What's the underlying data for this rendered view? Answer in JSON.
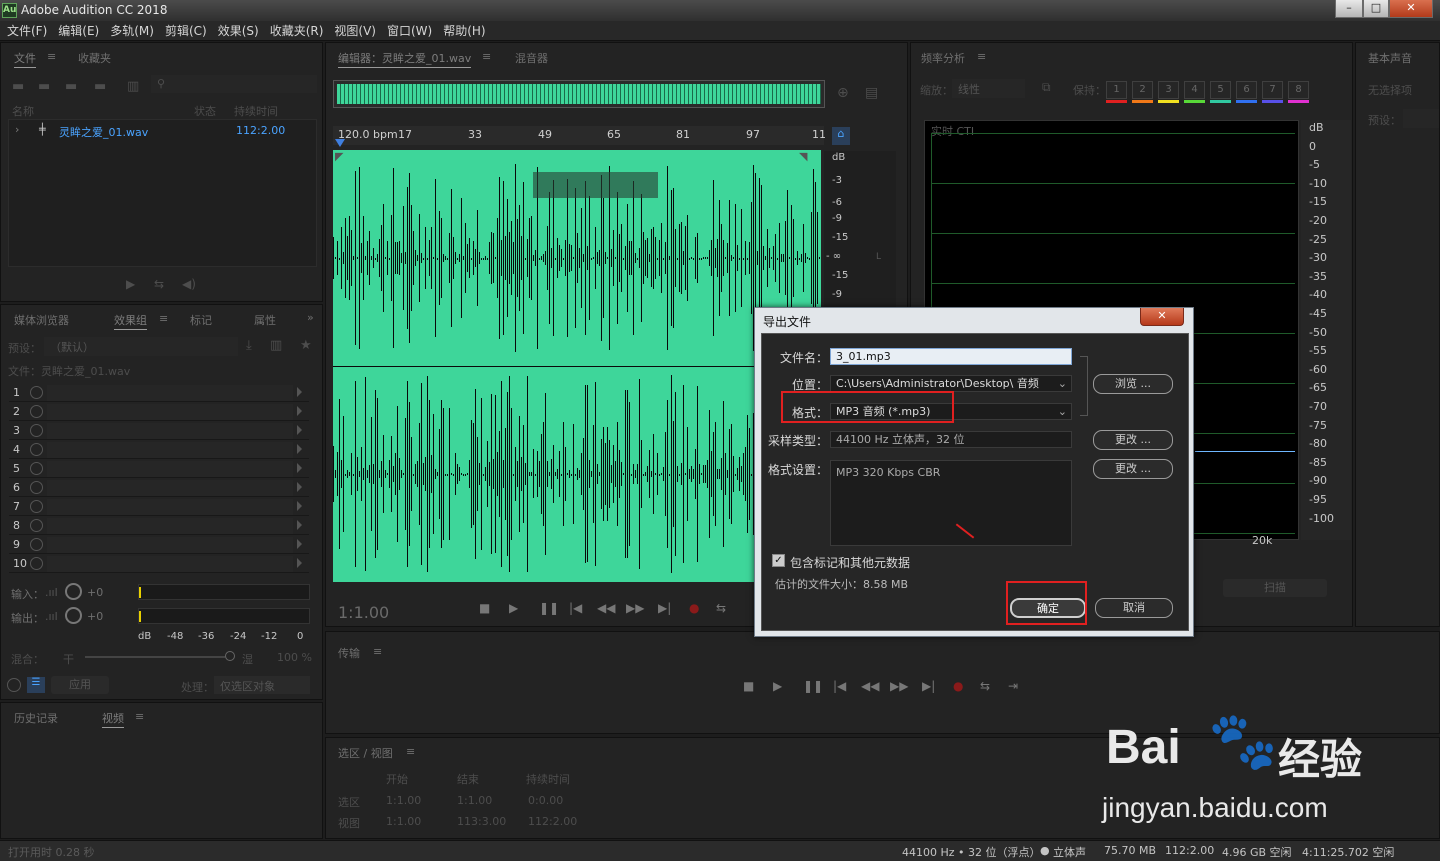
{
  "window": {
    "title": "Adobe Audition CC 2018",
    "app_icon": "Au",
    "min": "–",
    "max": "□",
    "close": "✕"
  },
  "menu": [
    "文件(F)",
    "编辑(E)",
    "多轨(M)",
    "剪辑(C)",
    "效果(S)",
    "收藏夹(R)",
    "视图(V)",
    "窗口(W)",
    "帮助(H)"
  ],
  "files": {
    "tab1": "文件",
    "tab2": "收藏夹",
    "col_name": "名称",
    "col_status": "状态",
    "col_duration": "持续时间",
    "file_name": "灵眸之爱_01.wav",
    "file_duration": "112:2.00"
  },
  "effects": {
    "tab_media": "媒体浏览器",
    "tab_rack": "效果组",
    "tab_markers": "标记",
    "tab_props": "属性",
    "preset_label": "预设：",
    "preset_value": "（默认）",
    "file_label": "文件：灵眸之爱_01.wav",
    "rows": [
      "1",
      "2",
      "3",
      "4",
      "5",
      "6",
      "7",
      "8",
      "9",
      "10"
    ],
    "input_label": "输入：",
    "output_label": "输出：",
    "input_val": "+0",
    "output_val": "+0",
    "db_ticks": [
      "dB",
      "-48",
      "-36",
      "-24",
      "-12",
      "0"
    ],
    "mix_label": "混合：",
    "mix_dry": "干",
    "mix_wet": "湿",
    "mix_pct": "100 %",
    "apply": "应用",
    "process_label": "处理：",
    "process_value": "仅选区对象"
  },
  "history": {
    "tab_history": "历史记录",
    "tab_video": "视频"
  },
  "editor": {
    "tab": "编辑器：灵眸之爱_01.wav",
    "tab_mixer": "混音器",
    "bpm": "120.0 bpm",
    "ruler": [
      "17",
      "33",
      "49",
      "65",
      "81",
      "97",
      "11"
    ],
    "db": [
      "dB",
      "-3",
      "-6",
      "-9",
      "-15",
      "- ∞",
      "-15",
      "-9"
    ],
    "timecode": "1:1.00",
    "channel_l": "L"
  },
  "transport": {
    "title": "传输"
  },
  "selection": {
    "title": "选区 / 视图",
    "h_start": "开始",
    "h_end": "结束",
    "h_duration": "持续时间",
    "sel_label": "选区",
    "sel_start": "1:1.00",
    "sel_end": "1:1.00",
    "sel_dur": "0:0.00",
    "view_label": "视图",
    "view_start": "1:1.00",
    "view_end": "113:3.00",
    "view_dur": "112:2.00"
  },
  "spectrum": {
    "title": "频率分析",
    "zoom_label": "缩放：",
    "zoom_value": "线性",
    "hold_label": "保持：",
    "holds": [
      "1",
      "2",
      "3",
      "4",
      "5",
      "6",
      "7",
      "8"
    ],
    "hold_colors": [
      "#e02020",
      "#f07818",
      "#f0e020",
      "#58d838",
      "#30c8a0",
      "#3070f0",
      "#5850e8",
      "#e030d0"
    ],
    "realtime": "实时 CTI",
    "db": [
      "dB",
      "0",
      "-5",
      "-10",
      "-15",
      "-20",
      "-25",
      "-30",
      "-35",
      "-40",
      "-45",
      "-50",
      "-55",
      "-60",
      "-65",
      "-70",
      "-75",
      "-80",
      "-85",
      "-90",
      "-95",
      "-100"
    ],
    "freq": "20k",
    "scan": "扫描"
  },
  "essential": {
    "title": "基本声音",
    "no_sel": "无选择项",
    "preset": "预设："
  },
  "dialog": {
    "title": "导出文件",
    "close": "✕",
    "filename_label": "文件名：",
    "filename": "3_01.mp3",
    "location_label": "位置：",
    "location": "C:\\Users\\Administrator\\Desktop\\ 音频",
    "browse": "浏览 ...",
    "format_label": "格式：",
    "format": "MP3 音频 (*.mp3)",
    "sample_label": "采样类型：",
    "sample": "44100 Hz 立体声，32 位",
    "change1": "更改 ...",
    "settings_label": "格式设置：",
    "settings": "MP3 320 Kbps CBR",
    "change2": "更改 ...",
    "include_meta": "包含标记和其他元数据",
    "est_size": "估计的文件大小：8.58 MB",
    "ok": "确定",
    "cancel": "取消"
  },
  "status": {
    "open_time": "打开用时 0.28 秒",
    "sample": "44100 Hz • 32 位（浮点）",
    "channels": "立体声",
    "size": "75.70 MB",
    "duration": "112:2.00",
    "free": "4.96 GB 空闲",
    "free_time": "4:11:25.702 空闲"
  },
  "watermark": {
    "brand": "Bai",
    "brand2": "经验",
    "url": "jingyan.baidu.com"
  }
}
